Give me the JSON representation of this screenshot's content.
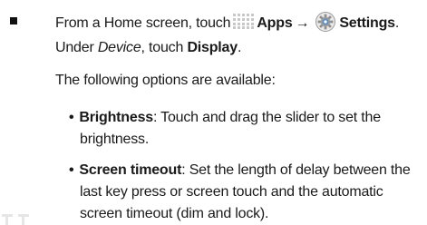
{
  "step": {
    "line1_prefix": "From a Home screen, touch",
    "apps_label": "Apps",
    "arrow": "→",
    "settings_label": "Settings",
    "period": ".",
    "line2_prefix": "Under ",
    "device_label": "Device",
    "line2_middle": ", touch ",
    "display_label": "Display",
    "line2_end": ".",
    "options_intro": "The following options are available:"
  },
  "options": [
    {
      "term": "Brightness",
      "desc_line1": ": Touch and drag the slider to set the",
      "desc_line2": "brightness."
    },
    {
      "term": "Screen timeout",
      "desc_line1": ": Set the length of delay between the",
      "desc_line2": "last key press or screen touch and the automatic",
      "desc_line3": "screen timeout (dim and lock)."
    }
  ],
  "bullet_char": "•",
  "icons": {
    "apps": "apps-grid-icon",
    "settings": "settings-gear-icon"
  },
  "colors": {
    "text": "#1a1a1a",
    "apps_icon": "#c8c8c8",
    "settings_icon_blue": "#5a8fc8"
  }
}
